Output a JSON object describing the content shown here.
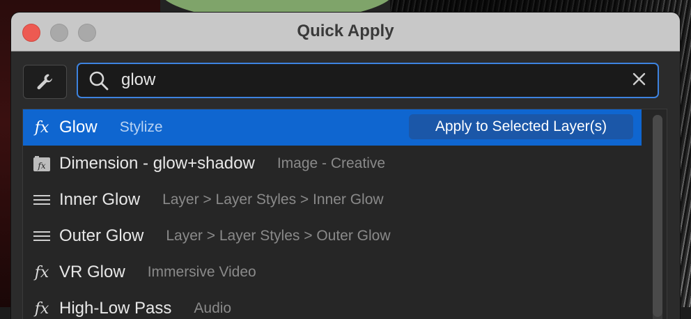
{
  "window": {
    "title": "Quick Apply"
  },
  "toolbar": {
    "settings_icon": "wrench-icon"
  },
  "search": {
    "value": "glow",
    "search_icon": "search-icon",
    "clear_icon": "close-icon"
  },
  "results": [
    {
      "icon": "fx-icon",
      "name": "Glow",
      "category": "Stylize",
      "selected": true,
      "action_label": "Apply to Selected Layer(s)"
    },
    {
      "icon": "preset-icon",
      "name": "Dimension - glow+shadow",
      "category": "Image - Creative",
      "selected": false
    },
    {
      "icon": "menu-icon",
      "name": "Inner Glow",
      "category": "Layer > Layer Styles > Inner Glow",
      "selected": false
    },
    {
      "icon": "menu-icon",
      "name": "Outer Glow",
      "category": "Layer > Layer Styles > Outer Glow",
      "selected": false
    },
    {
      "icon": "fx-icon",
      "name": "VR Glow",
      "category": "Immersive Video",
      "selected": false
    },
    {
      "icon": "fx-icon",
      "name": "High-Low Pass",
      "category": "Audio",
      "selected": false
    }
  ],
  "colors": {
    "selection": "#0f66d0",
    "focus_ring": "#3d83e0",
    "close_button": "#ed5a52"
  }
}
